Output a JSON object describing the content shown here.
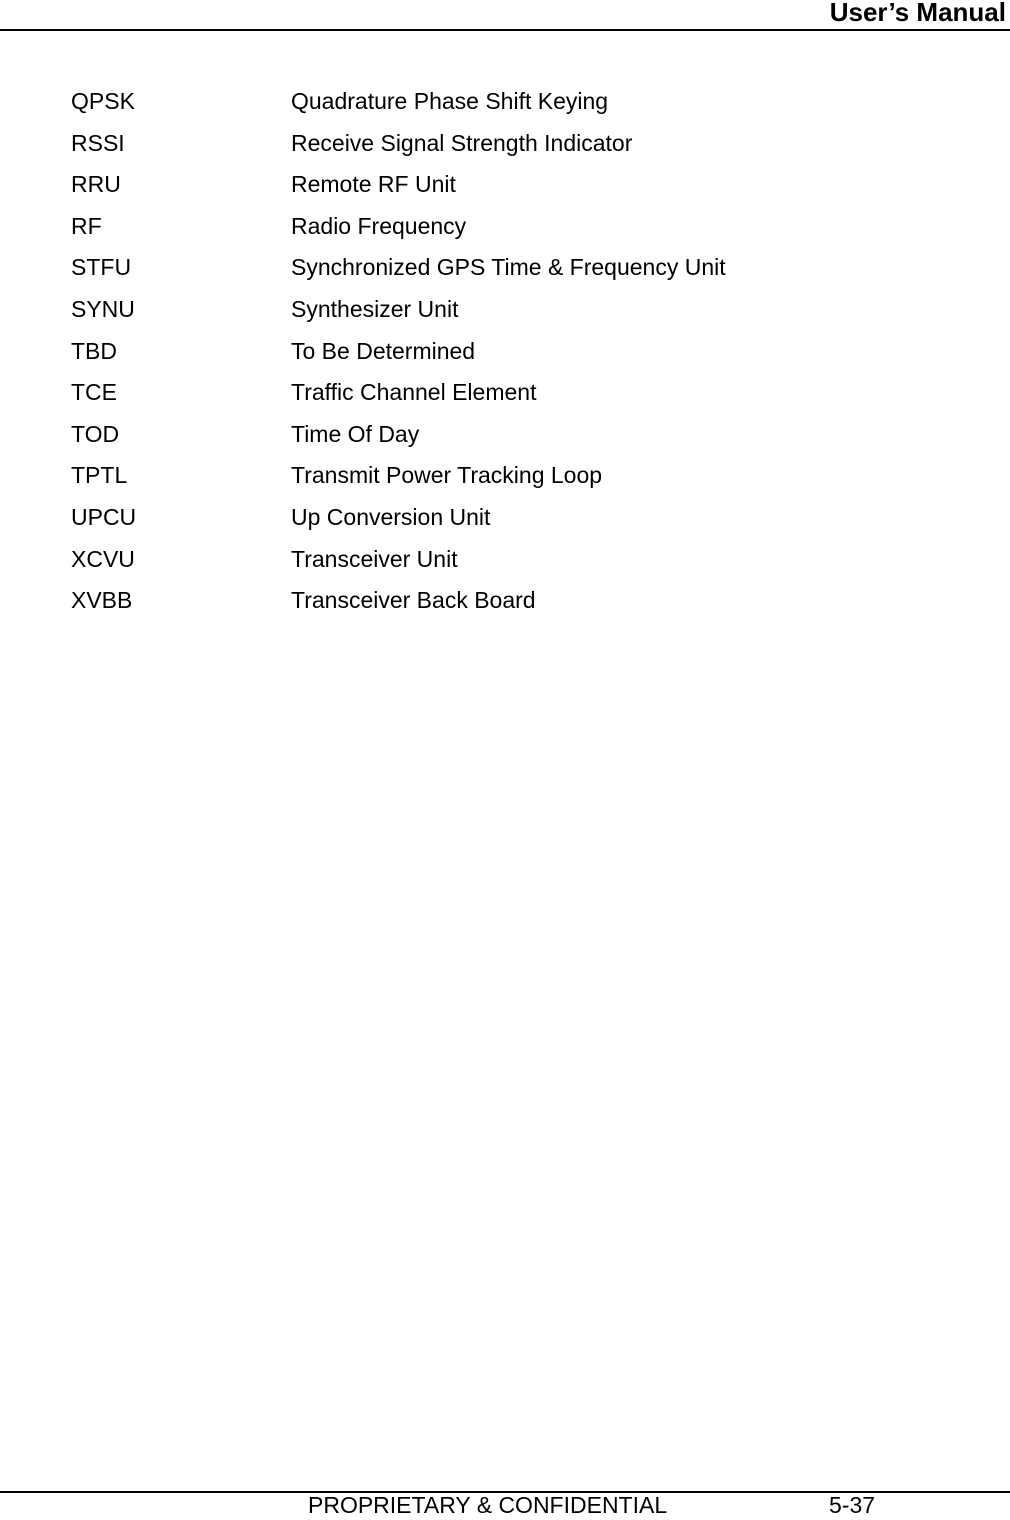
{
  "header": {
    "title": "User’s Manual"
  },
  "glossary": {
    "entries": [
      {
        "abbr": "QPSK",
        "definition": "Quadrature Phase Shift Keying"
      },
      {
        "abbr": "RSSI",
        "definition": "Receive Signal Strength Indicator"
      },
      {
        "abbr": "RRU",
        "definition": "Remote RF Unit"
      },
      {
        "abbr": "RF",
        "definition": "Radio Frequency"
      },
      {
        "abbr": "STFU",
        "definition": "Synchronized GPS Time & Frequency Unit"
      },
      {
        "abbr": "SYNU",
        "definition": "Synthesizer Unit"
      },
      {
        "abbr": "TBD",
        "definition": "To Be Determined"
      },
      {
        "abbr": "TCE",
        "definition": "Traffic Channel Element"
      },
      {
        "abbr": "TOD",
        "definition": "Time Of Day"
      },
      {
        "abbr": "TPTL",
        "definition": "Transmit Power Tracking Loop"
      },
      {
        "abbr": "UPCU",
        "definition": "Up Conversion Unit"
      },
      {
        "abbr": "XCVU",
        "definition": "Transceiver Unit"
      },
      {
        "abbr": "XVBB",
        "definition": "Transceiver Back Board"
      }
    ]
  },
  "footer": {
    "confidentiality": "PROPRIETARY & CONFIDENTIAL",
    "page_number": "5-37"
  }
}
